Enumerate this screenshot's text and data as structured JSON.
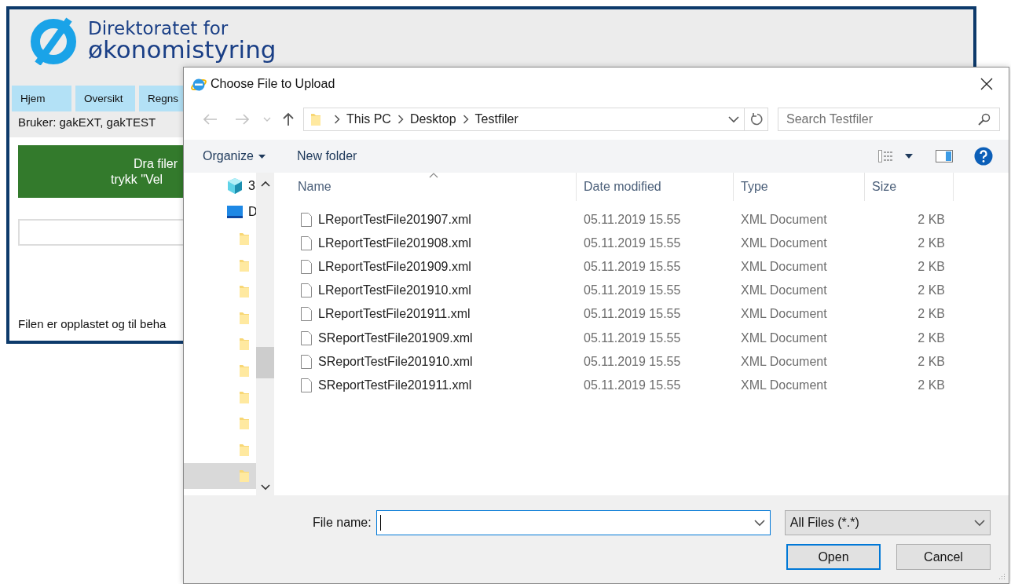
{
  "background_page": {
    "logo": {
      "line_1": "Direktoratet for",
      "line_2": "økonomistyring"
    },
    "tabs": [
      {
        "label": "Hjem"
      },
      {
        "label": "Oversikt"
      },
      {
        "label": "Regns"
      }
    ],
    "user": "Bruker: gakEXT, gakTEST",
    "drop_zone": {
      "line_1": "Dra filer",
      "line_2": "trykk \"Vel"
    },
    "status": "Filen er opplastet og til beha"
  },
  "dialog": {
    "title": "Choose File to Upload",
    "breadcrumb": [
      "This PC",
      "Desktop",
      "Testfiler"
    ],
    "search": {
      "placeholder": "Search Testfiler"
    },
    "toolbar": {
      "organize": "Organize",
      "new_folder": "New folder"
    },
    "nav_items": [
      {
        "kind": "objects",
        "label": "3",
        "selected": false
      },
      {
        "kind": "desktop",
        "label": "D",
        "selected": false
      },
      {
        "kind": "folder",
        "selected": false
      },
      {
        "kind": "folder",
        "selected": false
      },
      {
        "kind": "folder",
        "selected": false
      },
      {
        "kind": "folder",
        "selected": false
      },
      {
        "kind": "folder",
        "selected": false
      },
      {
        "kind": "folder",
        "selected": false
      },
      {
        "kind": "folder",
        "selected": false
      },
      {
        "kind": "folder",
        "selected": false
      },
      {
        "kind": "folder",
        "selected": false
      },
      {
        "kind": "folder",
        "selected": true
      }
    ],
    "columns": [
      "Name",
      "Date modified",
      "Type",
      "Size"
    ],
    "files": [
      {
        "name": "LReportTestFile201907.xml",
        "date": "05.11.2019 15.55",
        "type": "XML Document",
        "size": "2 KB"
      },
      {
        "name": "LReportTestFile201908.xml",
        "date": "05.11.2019 15.55",
        "type": "XML Document",
        "size": "2 KB"
      },
      {
        "name": "LReportTestFile201909.xml",
        "date": "05.11.2019 15.55",
        "type": "XML Document",
        "size": "2 KB"
      },
      {
        "name": "LReportTestFile201910.xml",
        "date": "05.11.2019 15.55",
        "type": "XML Document",
        "size": "2 KB"
      },
      {
        "name": "LReportTestFile201911.xml",
        "date": "05.11.2019 15.55",
        "type": "XML Document",
        "size": "2 KB"
      },
      {
        "name": "SReportTestFile201909.xml",
        "date": "05.11.2019 15.55",
        "type": "XML Document",
        "size": "2 KB"
      },
      {
        "name": "SReportTestFile201910.xml",
        "date": "05.11.2019 15.55",
        "type": "XML Document",
        "size": "2 KB"
      },
      {
        "name": "SReportTestFile201911.xml",
        "date": "05.11.2019 15.55",
        "type": "XML Document",
        "size": "2 KB"
      }
    ],
    "file_name": {
      "label": "File name:"
    },
    "filter": "All Files (*.*)",
    "buttons": [
      "Open",
      "Cancel"
    ]
  }
}
